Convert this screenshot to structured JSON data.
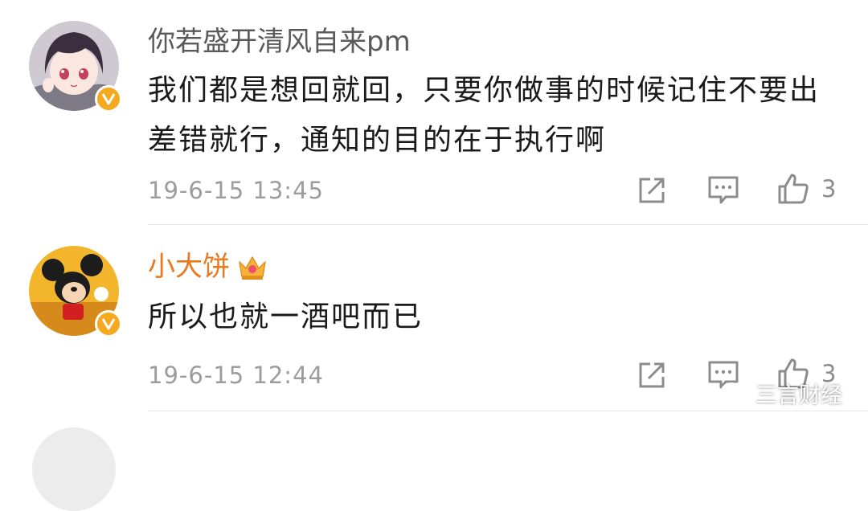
{
  "comments": [
    {
      "username": "你若盛开清风自来pm",
      "username_color": "#5a5a5a",
      "text": "我们都是想回就回，只要你做事的时候记住不要出差错就行，通知的目的在于执行啊",
      "timestamp": "19-6-15 13:45",
      "likes": "3",
      "verified_badge": "v-badge-icon"
    },
    {
      "username": "小大饼",
      "username_color": "#e8791e",
      "text": "所以也就一酒吧而已",
      "timestamp": "19-6-15 12:44",
      "likes": "3",
      "verified_badge": "v-badge-icon",
      "member_badge": "crown-icon"
    }
  ],
  "watermark": {
    "label": "三言财经",
    "icon": "wechat-icon"
  },
  "colors": {
    "badge": "#f4a91e",
    "icon_gray": "#8c8c8c",
    "divider": "#e6e6e6"
  }
}
